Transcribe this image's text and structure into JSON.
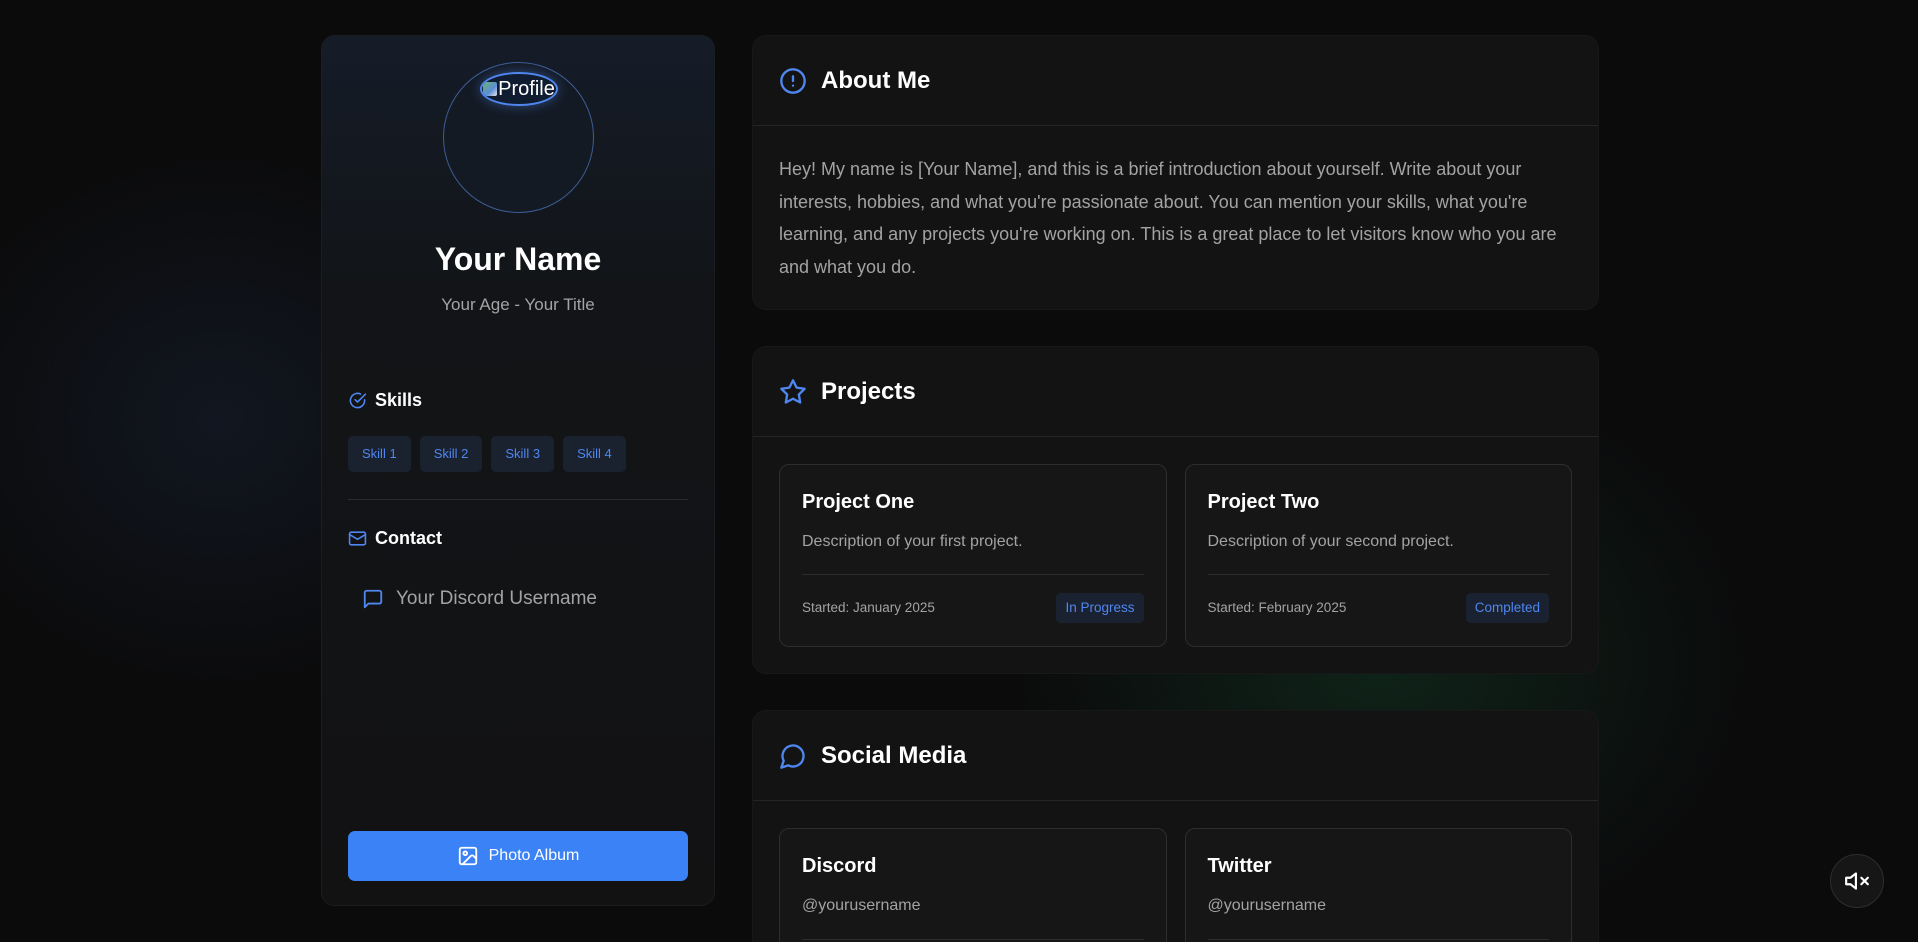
{
  "profile": {
    "avatar_alt": "Profile",
    "name": "Your Name",
    "subtitle": "Your Age - Your Title",
    "skills_heading": "Skills",
    "skills": [
      "Skill 1",
      "Skill 2",
      "Skill 3",
      "Skill 4"
    ],
    "contact_heading": "Contact",
    "discord_username": "Your Discord Username",
    "album_button": "Photo Album"
  },
  "about": {
    "heading": "About Me",
    "text": "Hey! My name is [Your Name], and this is a brief introduction about yourself. Write about your interests, hobbies, and what you're passionate about. You can mention your skills, what you're learning, and any projects you're working on. This is a great place to let visitors know who you are and what you do."
  },
  "projects": {
    "heading": "Projects",
    "items": [
      {
        "title": "Project One",
        "description": "Description of your first project.",
        "started": "Started: January 2025",
        "status": "In Progress"
      },
      {
        "title": "Project Two",
        "description": "Description of your second project.",
        "started": "Started: February 2025",
        "status": "Completed"
      }
    ]
  },
  "social": {
    "heading": "Social Media",
    "items": [
      {
        "name": "Discord",
        "handle": "@yourusername"
      },
      {
        "name": "Twitter",
        "handle": "@yourusername"
      }
    ]
  },
  "icons": {
    "about": "info-circle-icon",
    "projects": "star-icon",
    "social": "chat-bubble-icon",
    "skills": "check-circle-icon",
    "contact": "mail-icon",
    "discord": "message-square-icon",
    "album": "image-icon",
    "mute": "volume-mute-icon"
  },
  "colors": {
    "accent": "#3b82f6",
    "background": "#0b0b0c",
    "panel": "#131313",
    "muted_text": "#a3a3a3"
  }
}
